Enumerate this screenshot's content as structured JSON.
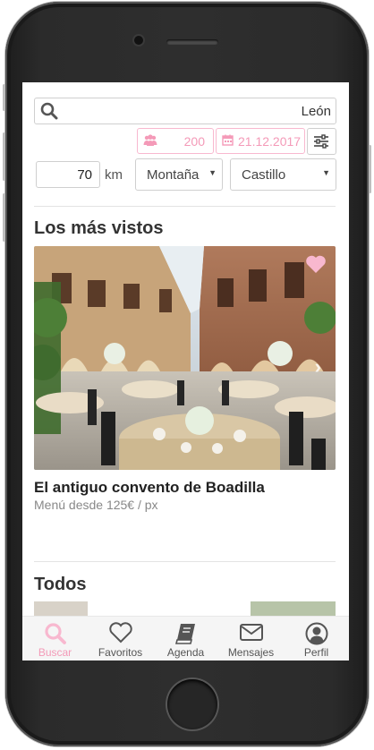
{
  "search": {
    "location": "León"
  },
  "filters": {
    "guests": "200",
    "date": "21.12.2017",
    "distance_value": "70",
    "distance_unit": "km",
    "environment": "Montaña",
    "venue_type": "Castillo"
  },
  "most_viewed": {
    "title": "Los más vistos",
    "card": {
      "name": "El antiguo convento de Boadilla",
      "price": "Menú desde 125€ / px"
    }
  },
  "all": {
    "title": "Todos"
  },
  "nav": {
    "items": [
      {
        "label": "Buscar",
        "icon": "search-icon",
        "active": true
      },
      {
        "label": "Favoritos",
        "icon": "heart-icon",
        "active": false
      },
      {
        "label": "Agenda",
        "icon": "book-icon",
        "active": false
      },
      {
        "label": "Mensajes",
        "icon": "envelope-icon",
        "active": false
      },
      {
        "label": "Perfil",
        "icon": "user-icon",
        "active": false
      }
    ]
  },
  "colors": {
    "accent": "#f49ab8",
    "accent_border": "#f8b8cf",
    "nav_bg": "#f5f5f5"
  }
}
